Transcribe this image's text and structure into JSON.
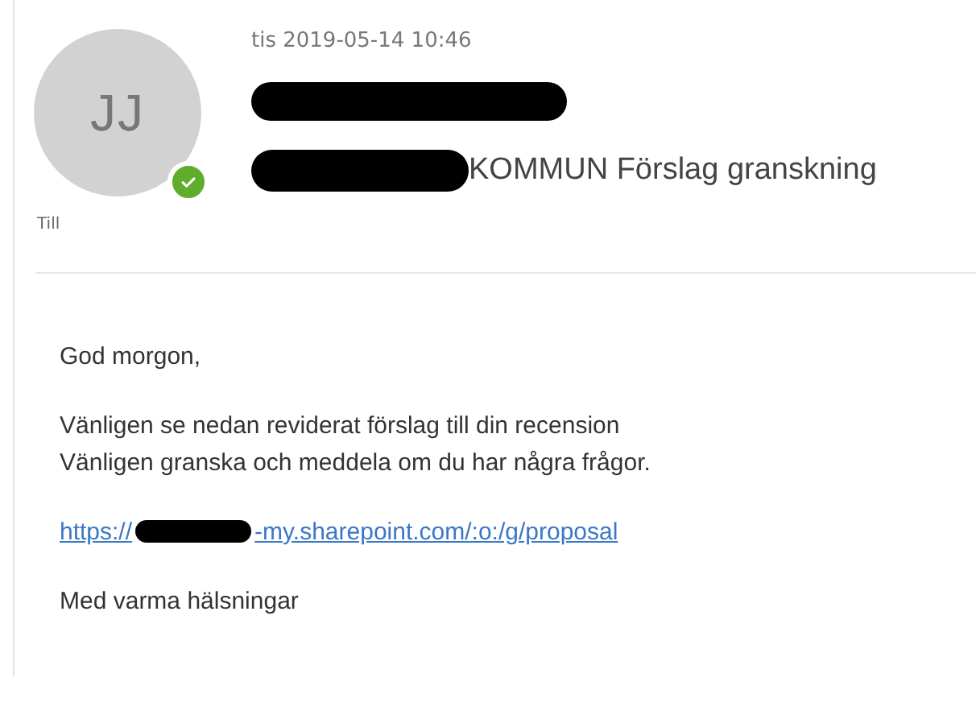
{
  "message": {
    "avatar_initials": "JJ",
    "available": true,
    "date": "tis 2019-05-14 10:46",
    "sender": {
      "redacted": true
    },
    "subject": {
      "redacted_prefix": true,
      "text": "KOMMUN Förslag granskning"
    },
    "to_label": "Till"
  },
  "body": [
    {
      "kind": "paragraph",
      "lines": [
        "God morgon,"
      ]
    },
    {
      "kind": "paragraph",
      "lines": [
        "Vänligen se nedan reviderat förslag till din recension",
        "Vänligen granska och meddela om du har några frågor."
      ]
    },
    {
      "kind": "link",
      "prefix": "https://",
      "redacted": true,
      "suffix": "-my.sharepoint.com/:o:/g/proposal"
    },
    {
      "kind": "paragraph",
      "lines": [
        "Med varma hälsningar"
      ]
    }
  ]
}
